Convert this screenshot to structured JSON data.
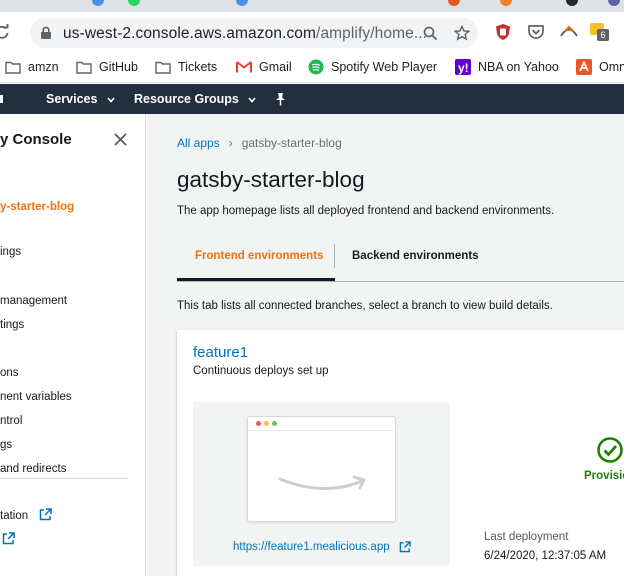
{
  "browser": {
    "url_host": "us-west-2.console.aws.amazon.com",
    "url_path": "/amplify/home...",
    "extension_badge": "6",
    "bookmarks": [
      {
        "label": "amzn",
        "icon": "folder-icon"
      },
      {
        "label": "GitHub",
        "icon": "folder-icon"
      },
      {
        "label": "Tickets",
        "icon": "folder-icon"
      },
      {
        "label": "Gmail",
        "icon": "gmail-icon"
      },
      {
        "label": "Spotify Web Player",
        "icon": "spotify-icon"
      },
      {
        "label": "NBA on Yahoo",
        "icon": "yahoo-icon"
      },
      {
        "label": "Omn",
        "icon": "omni-icon"
      }
    ]
  },
  "aws_nav": {
    "services_label": "Services",
    "resource_groups_label": "Resource Groups"
  },
  "sidebar": {
    "title": "y Console",
    "items": [
      {
        "label": "y-starter-blog",
        "active": true
      },
      {
        "label": "ings"
      },
      {
        "label": "management"
      },
      {
        "label": "tings"
      },
      {
        "label": "ons"
      },
      {
        "label": "nent variables"
      },
      {
        "label": "ntrol"
      },
      {
        "label": "gs"
      },
      {
        "label": "and redirects"
      },
      {
        "label": "tation"
      }
    ]
  },
  "main": {
    "breadcrumb_root": "All apps",
    "breadcrumb_current": "gatsby-starter-blog",
    "title": "gatsby-starter-blog",
    "description": "The app homepage lists all deployed frontend and backend environments.",
    "tabs": [
      {
        "label": "Frontend environments",
        "active": true
      },
      {
        "label": "Backend environments",
        "active": false
      }
    ],
    "tab_info": "This tab lists all connected branches, select a branch to view build details.",
    "branch": {
      "name": "feature1",
      "description": "Continuous deploys set up",
      "url": "https://feature1.mealicious.app",
      "status": "Provisio",
      "last_deployment_label": "Last deployment",
      "last_deployment_value": "6/24/2020, 12:37:05 AM"
    }
  },
  "colors": {
    "aws_nav_bg": "#232f3e",
    "link_blue": "#0073bb",
    "active_orange": "#ec7211",
    "success_green": "#1d8102"
  }
}
